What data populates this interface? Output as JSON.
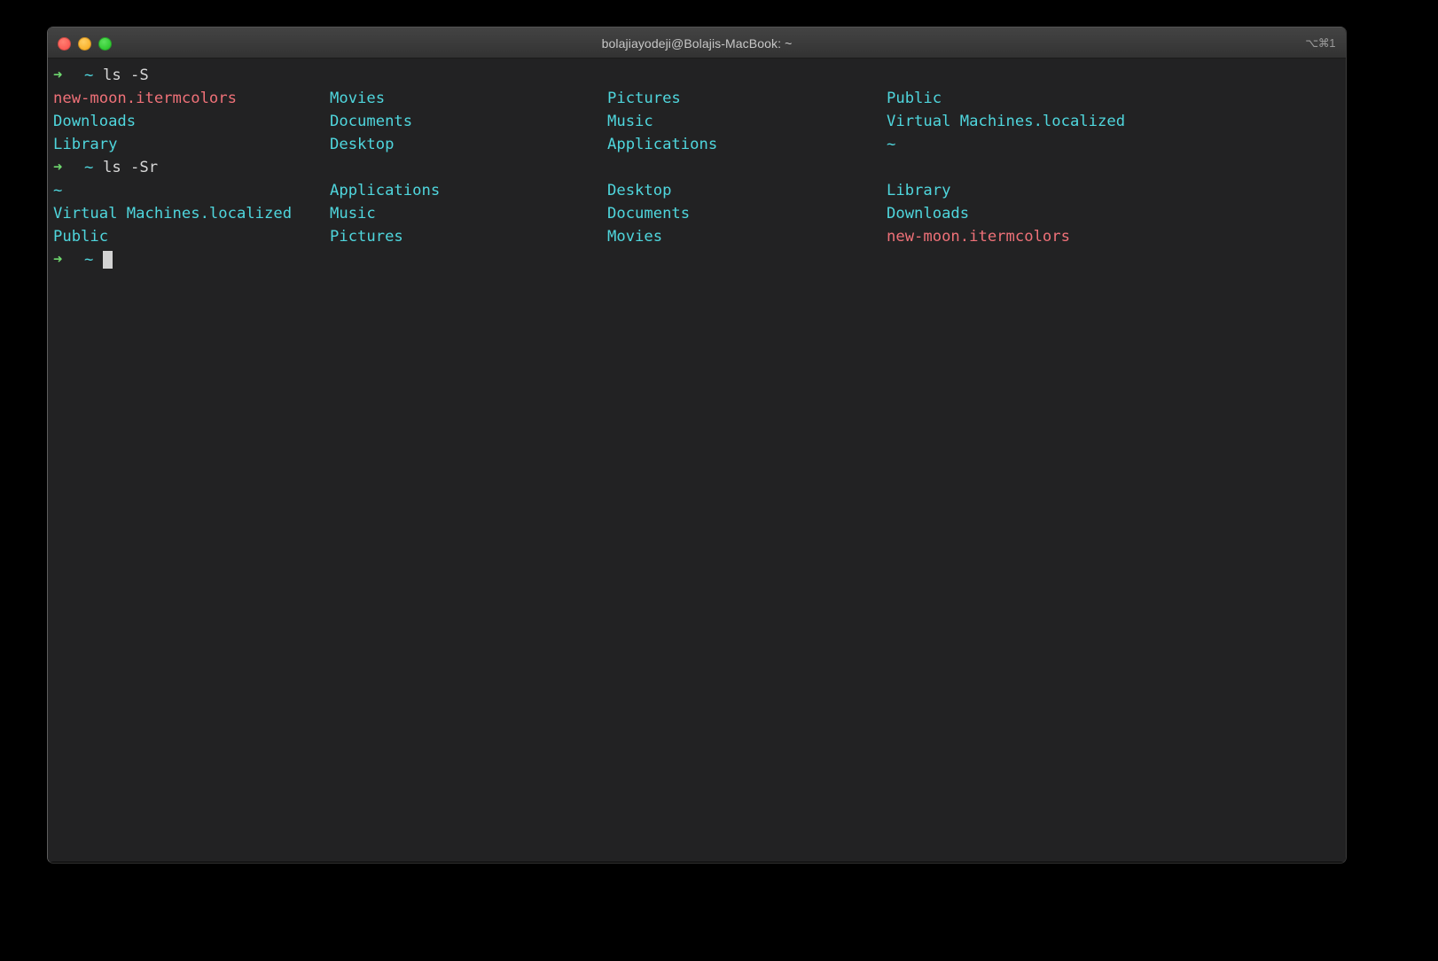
{
  "window": {
    "title": "bolajiayodeji@Bolajis-MacBook: ~",
    "shortcut": "⌥⌘1",
    "traffic_lights": {
      "close_label": "close",
      "minimize_label": "minimize",
      "maximize_label": "maximize"
    },
    "colors": {
      "titlebar": "#3b3b3b",
      "background": "#222223",
      "directory": "#4fd6dd",
      "file": "#ef7178",
      "prompt_arrow": "#6fd86f",
      "prompt_path": "#4fd6dd",
      "command_text": "#d8d8d8",
      "cursor": "#d3d3d3",
      "close_button": "#fb5953",
      "minimize_button": "#f9b12a",
      "maximize_button": "#2fc92f"
    }
  },
  "session": {
    "prompt_symbol": "➜",
    "prompt_path": "~",
    "blocks": [
      {
        "command": "ls -S",
        "rows": [
          [
            {
              "text": "new-moon.itermcolors",
              "kind": "file"
            },
            {
              "text": "Movies",
              "kind": "dir"
            },
            {
              "text": "Pictures",
              "kind": "dir"
            },
            {
              "text": "Public",
              "kind": "dir"
            }
          ],
          [
            {
              "text": "Downloads",
              "kind": "dir"
            },
            {
              "text": "Documents",
              "kind": "dir"
            },
            {
              "text": "Music",
              "kind": "dir"
            },
            {
              "text": "Virtual Machines.localized",
              "kind": "dir"
            }
          ],
          [
            {
              "text": "Library",
              "kind": "dir"
            },
            {
              "text": "Desktop",
              "kind": "dir"
            },
            {
              "text": "Applications",
              "kind": "dir"
            },
            {
              "text": "~",
              "kind": "dir"
            }
          ]
        ]
      },
      {
        "command": "ls -Sr",
        "rows": [
          [
            {
              "text": "~",
              "kind": "dir"
            },
            {
              "text": "Applications",
              "kind": "dir"
            },
            {
              "text": "Desktop",
              "kind": "dir"
            },
            {
              "text": "Library",
              "kind": "dir"
            }
          ],
          [
            {
              "text": "Virtual Machines.localized",
              "kind": "dir"
            },
            {
              "text": "Music",
              "kind": "dir"
            },
            {
              "text": "Documents",
              "kind": "dir"
            },
            {
              "text": "Downloads",
              "kind": "dir"
            }
          ],
          [
            {
              "text": "Public",
              "kind": "dir"
            },
            {
              "text": "Pictures",
              "kind": "dir"
            },
            {
              "text": "Movies",
              "kind": "dir"
            },
            {
              "text": "new-moon.itermcolors",
              "kind": "file"
            }
          ]
        ]
      }
    ],
    "current_prompt": {
      "command": "",
      "cursor_visible": true
    }
  }
}
